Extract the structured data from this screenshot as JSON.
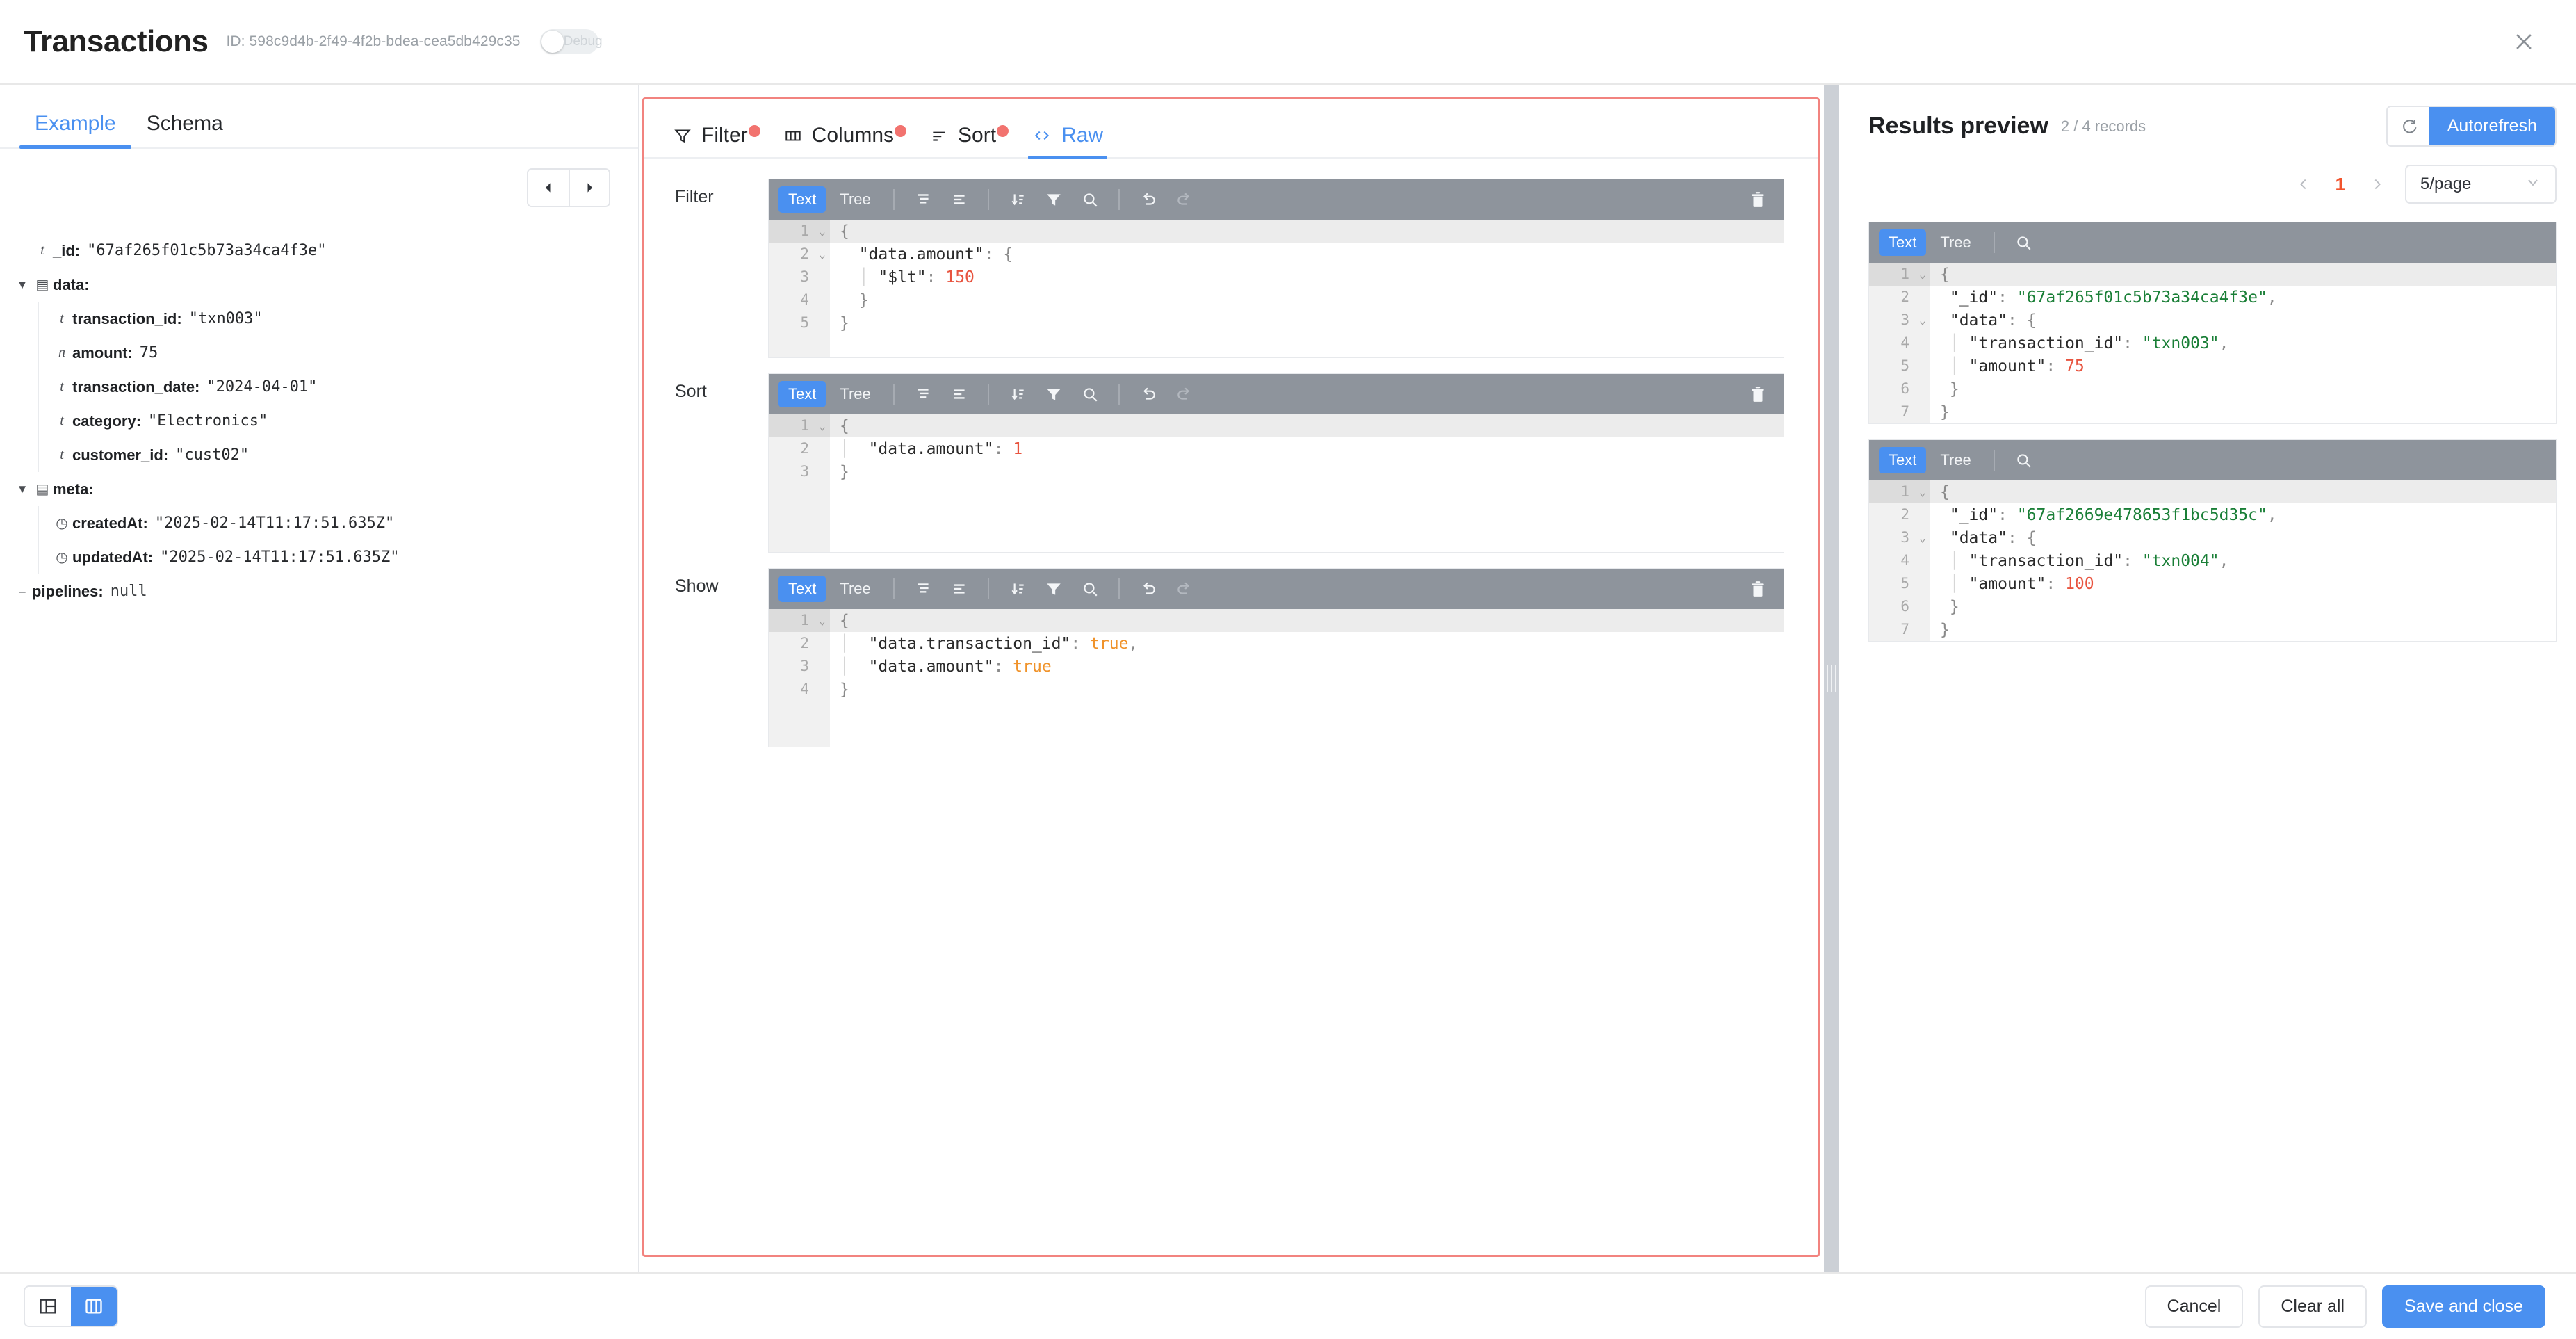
{
  "header": {
    "title": "Transactions",
    "id_label": "ID: 598c9d4b-2f49-4f2b-bdea-cea5db429c35",
    "debug_label": "Debug",
    "close_icon": "close-icon"
  },
  "left_panel": {
    "tabs": [
      {
        "label": "Example",
        "active": true
      },
      {
        "label": "Schema",
        "active": false
      }
    ],
    "pager": {
      "prev_icon": "chevron-left-icon",
      "next_icon": "chevron-right-icon"
    },
    "tree": [
      {
        "kind": "t",
        "key": "_id:",
        "value": "\"67af265f01c5b73a34ca4f3e\""
      },
      {
        "kind": "object",
        "key": "data:",
        "value": ""
      },
      {
        "kind": "t",
        "key": "transaction_id:",
        "value": "\"txn003\""
      },
      {
        "kind": "n",
        "key": "amount:",
        "value": "75"
      },
      {
        "kind": "t",
        "key": "transaction_date:",
        "value": "\"2024-04-01\""
      },
      {
        "kind": "t",
        "key": "category:",
        "value": "\"Electronics\""
      },
      {
        "kind": "t",
        "key": "customer_id:",
        "value": "\"cust02\""
      },
      {
        "kind": "object",
        "key": "meta:",
        "value": ""
      },
      {
        "kind": "clock",
        "key": "createdAt:",
        "value": "\"2025-02-14T11:17:51.635Z\""
      },
      {
        "kind": "clock",
        "key": "updatedAt:",
        "value": "\"2025-02-14T11:17:51.635Z\""
      },
      {
        "kind": "dash",
        "key": "pipelines:",
        "value": "null"
      }
    ]
  },
  "center_panel": {
    "tabs": [
      {
        "label": "Filter",
        "icon": "funnel-icon",
        "badge": true,
        "active": false
      },
      {
        "label": "Columns",
        "icon": "columns-icon",
        "badge": true,
        "active": false
      },
      {
        "label": "Sort",
        "icon": "sort-icon",
        "badge": true,
        "active": false
      },
      {
        "label": "Raw",
        "icon": "code-icon",
        "badge": false,
        "active": true
      }
    ],
    "toolbar": {
      "text_label": "Text",
      "tree_label": "Tree",
      "format_icon": "format-icon",
      "compact_icon": "compact-icon",
      "sort_icon": "sort-az-icon",
      "filter_icon": "funnel-icon",
      "search_icon": "search-icon",
      "undo_icon": "undo-icon",
      "redo_icon": "redo-icon",
      "delete_icon": "trash-icon"
    },
    "editors": [
      {
        "label": "Filter",
        "lines": [
          {
            "n": "1",
            "fold": true,
            "code": "{"
          },
          {
            "n": "2",
            "fold": true,
            "code": "  \"data.amount\": {",
            "key_end": 16
          },
          {
            "n": "3",
            "fold": false,
            "code": "    \"$lt\": 150"
          },
          {
            "n": "4",
            "fold": false,
            "code": "  }"
          },
          {
            "n": "5",
            "fold": false,
            "code": "}"
          }
        ]
      },
      {
        "label": "Sort",
        "lines": [
          {
            "n": "1",
            "fold": true,
            "code": "{"
          },
          {
            "n": "2",
            "fold": false,
            "code": "  \"data.amount\": 1"
          },
          {
            "n": "3",
            "fold": false,
            "code": "}"
          }
        ]
      },
      {
        "label": "Show",
        "lines": [
          {
            "n": "1",
            "fold": true,
            "code": "{"
          },
          {
            "n": "2",
            "fold": false,
            "code": "  \"data.transaction_id\": true,"
          },
          {
            "n": "3",
            "fold": false,
            "code": "  \"data.amount\": true"
          },
          {
            "n": "4",
            "fold": false,
            "code": "}"
          }
        ]
      }
    ]
  },
  "right_panel": {
    "title": "Results preview",
    "count": "2 / 4 records",
    "refresh_icon": "refresh-icon",
    "autorefresh_label": "Autorefresh",
    "pager": {
      "prev_icon": "chevron-left-icon",
      "page": "1",
      "next_icon": "chevron-right-icon"
    },
    "per_page": "5/page",
    "toolbar": {
      "text_label": "Text",
      "tree_label": "Tree",
      "search_icon": "search-icon"
    },
    "results": [
      {
        "lines": [
          {
            "n": "1",
            "fold": true,
            "code": "{"
          },
          {
            "n": "2",
            "fold": false,
            "code": "  \"_id\": \"67af265f01c5b73a34ca4f3e\","
          },
          {
            "n": "3",
            "fold": true,
            "code": "  \"data\": {"
          },
          {
            "n": "4",
            "fold": false,
            "code": "    \"transaction_id\": \"txn003\","
          },
          {
            "n": "5",
            "fold": false,
            "code": "    \"amount\": 75"
          },
          {
            "n": "6",
            "fold": false,
            "code": "  }"
          },
          {
            "n": "7",
            "fold": false,
            "code": "}"
          }
        ]
      },
      {
        "lines": [
          {
            "n": "1",
            "fold": true,
            "code": "{"
          },
          {
            "n": "2",
            "fold": false,
            "code": "  \"_id\": \"67af2669e478653f1bc5d35c\","
          },
          {
            "n": "3",
            "fold": true,
            "code": "  \"data\": {"
          },
          {
            "n": "4",
            "fold": false,
            "code": "    \"transaction_id\": \"txn004\","
          },
          {
            "n": "5",
            "fold": false,
            "code": "    \"amount\": 100"
          },
          {
            "n": "6",
            "fold": false,
            "code": "  }"
          },
          {
            "n": "7",
            "fold": false,
            "code": "}"
          }
        ]
      }
    ]
  },
  "footer": {
    "layout_two_icon": "layout-two-column-icon",
    "layout_three_icon": "layout-three-column-icon",
    "cancel_label": "Cancel",
    "clear_all_label": "Clear all",
    "save_label": "Save and close"
  },
  "colors": {
    "accent": "#4a90f0",
    "badge": "#f2736f",
    "panel_border": "#f2837f",
    "page_number": "#f2542d",
    "json_string": "#1a7f37",
    "json_number": "#e8543f",
    "json_bool": "#f0932b",
    "toolbar_bg": "#8e949c"
  }
}
